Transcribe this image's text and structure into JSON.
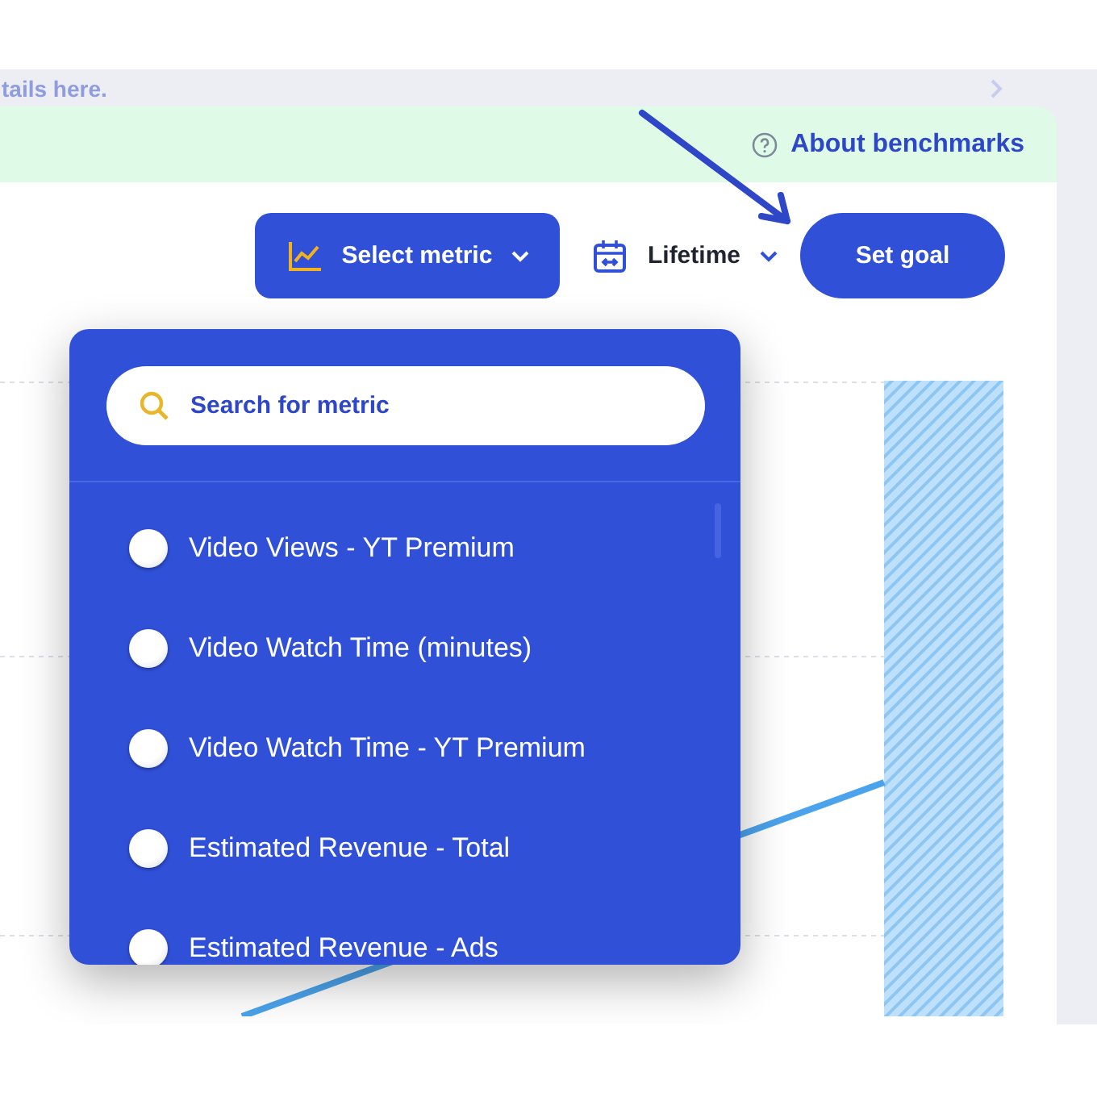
{
  "hint_text": "tails here.",
  "banner": {
    "link": "About benchmarks"
  },
  "toolbar": {
    "metric_button": "Select metric",
    "date_range": "Lifetime",
    "goal_button": "Set goal"
  },
  "metric_dropdown": {
    "open": true,
    "search": {
      "placeholder": "Search for metric"
    },
    "options": [
      {
        "label": "Video Views - YT Premium",
        "selected": false
      },
      {
        "label": "Video Watch Time (minutes)",
        "selected": false
      },
      {
        "label": "Video Watch Time - YT Premium",
        "selected": false
      },
      {
        "label": "Estimated Revenue - Total",
        "selected": false
      },
      {
        "label": "Estimated Revenue - Ads",
        "selected": false
      }
    ]
  }
}
